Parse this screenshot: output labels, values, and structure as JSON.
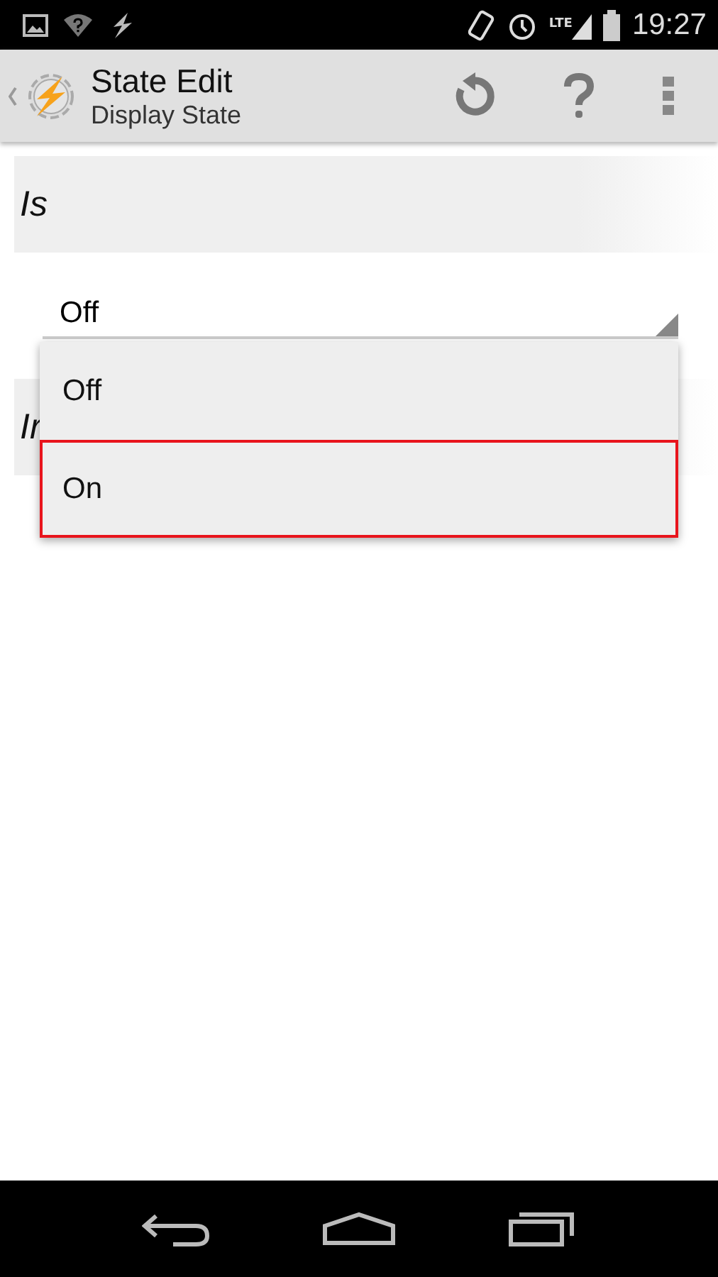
{
  "status_bar": {
    "time": "19:27",
    "network": "LTE"
  },
  "action_bar": {
    "title": "State Edit",
    "subtitle": "Display State"
  },
  "sections": [
    {
      "header": "Is",
      "value": "Off"
    },
    {
      "header": "Ir"
    }
  ],
  "dropdown": {
    "options": [
      {
        "label": "Off",
        "highlighted": false
      },
      {
        "label": "On",
        "highlighted": true
      }
    ]
  }
}
